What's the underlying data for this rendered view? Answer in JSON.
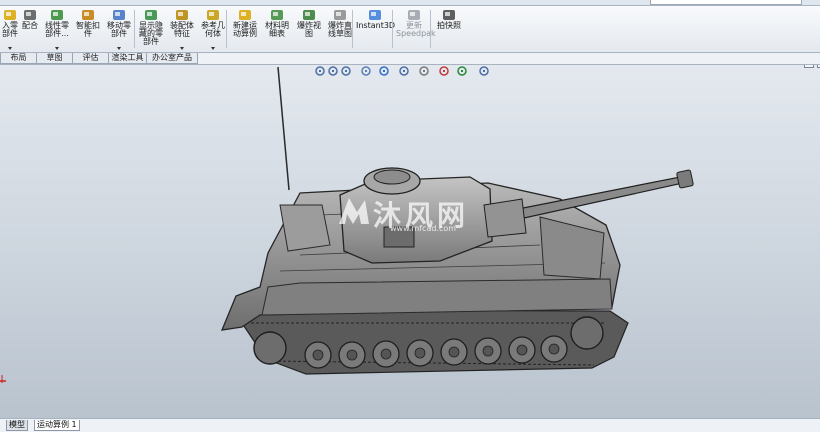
{
  "ribbon": {
    "commands": [
      {
        "id": "insert-parts",
        "label": "入零\n部件",
        "icon": "insert-part-icon",
        "dropdown": true
      },
      {
        "id": "mate",
        "label": "配合",
        "icon": "paperclip-mate-icon",
        "dropdown": false
      },
      {
        "id": "linear-pattern",
        "label": "线性零\n部件...",
        "icon": "linear-pattern-icon",
        "dropdown": true
      },
      {
        "id": "smart-fasteners",
        "label": "智能扣\n件",
        "icon": "smart-fastener-icon",
        "dropdown": false
      },
      {
        "id": "move-component",
        "label": "移动零\n部件",
        "icon": "move-component-icon",
        "dropdown": true
      },
      {
        "id": "show-hidden",
        "label": "显示隐\n藏的零\n部件",
        "icon": "show-hidden-icon",
        "dropdown": false
      },
      {
        "id": "assembly-features",
        "label": "装配体\n特征",
        "icon": "assembly-feature-icon",
        "dropdown": true
      },
      {
        "id": "reference-geometry",
        "label": "参考几\n何体",
        "icon": "reference-geometry-icon",
        "dropdown": true
      },
      {
        "id": "new-motion-study",
        "label": "新建运\n动算例",
        "icon": "motion-study-icon",
        "dropdown": false
      },
      {
        "id": "bom",
        "label": "材料明\n细表",
        "icon": "bom-table-icon",
        "dropdown": false
      },
      {
        "id": "exploded-view",
        "label": "爆炸视\n图",
        "icon": "exploded-view-icon",
        "dropdown": false
      },
      {
        "id": "explode-line-sketch",
        "label": "爆炸直\n线草图",
        "icon": "explode-line-icon",
        "dropdown": false
      },
      {
        "id": "instant3d",
        "label": "Instant3D",
        "icon": "instant3d-icon",
        "dropdown": false
      },
      {
        "id": "update-speedpak",
        "label": "更新\nSpeedpak",
        "icon": "speedpak-icon",
        "dropdown": false,
        "disabled": true
      },
      {
        "id": "take-snapshot",
        "label": "拍快照",
        "icon": "camera-snapshot-icon",
        "dropdown": false
      }
    ]
  },
  "command_tabs": [
    "布局",
    "草图",
    "评估",
    "渲染工具",
    "办公室产品"
  ],
  "heads_up_toolbar": [
    "zoom-to-fit-icon",
    "zoom-area-icon",
    "previous-view-icon",
    "section-view-icon",
    "view-orientation-icon",
    "display-style-icon",
    "hide-show-items-icon",
    "edit-appearance-icon",
    "apply-scene-icon",
    "view-settings-icon"
  ],
  "window_buttons": [
    "restore-icon",
    "maximize-icon"
  ],
  "watermark": {
    "big": "沐风网",
    "small": "www.mfcad.com"
  },
  "bottom_tabs": [
    "模型",
    "运动算例 1"
  ],
  "colors": {
    "tank_fill": "#8f8f8f",
    "tank_dark": "#3a3a3a",
    "viewport_top": "#e4e9ef",
    "viewport_bottom": "#b9c3ce"
  }
}
